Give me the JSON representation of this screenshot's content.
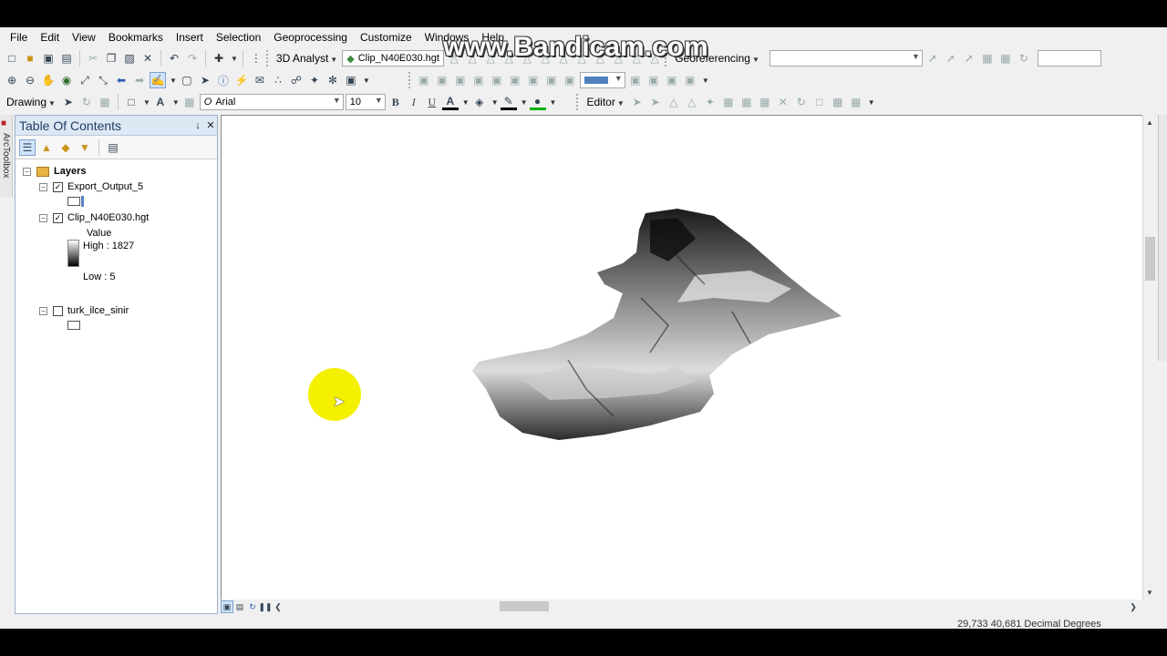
{
  "menu": [
    "File",
    "Edit",
    "View",
    "Bookmarks",
    "Insert",
    "Selection",
    "Geoprocessing",
    "Customize",
    "Windows",
    "Help"
  ],
  "toolbar1": {
    "analyst_label": "3D Analyst",
    "layer_combo": "Clip_N40E030.hgt",
    "georef_label": "Georeferencing",
    "scale_value": ""
  },
  "toolbar3": {
    "drawing_label": "Drawing",
    "font_name": "Arial",
    "font_size": "10",
    "bold": "B",
    "italic": "I",
    "underline": "U",
    "font_color_glyph": "A",
    "editor_label": "Editor"
  },
  "toc": {
    "title": "Table Of Contents",
    "pin": "↓",
    "close": "✕",
    "root_label": "Layers",
    "layers": [
      {
        "name": "Export_Output_5",
        "checked": true
      },
      {
        "name": "Clip_N40E030.hgt",
        "checked": true,
        "legend_title": "Value",
        "high": "High : 1827",
        "low": "Low : 5"
      },
      {
        "name": "turk_ilce_sinir",
        "checked": false
      }
    ]
  },
  "left_strip_label": "ArcToolbox",
  "status": {
    "coords": "29,733  40,681 Decimal Degrees"
  },
  "watermark": "www.Bandicam.com",
  "colors": {
    "toc_header": "#dde8f5",
    "highlight": "#f5f000",
    "accent": "#1e3a5f"
  }
}
